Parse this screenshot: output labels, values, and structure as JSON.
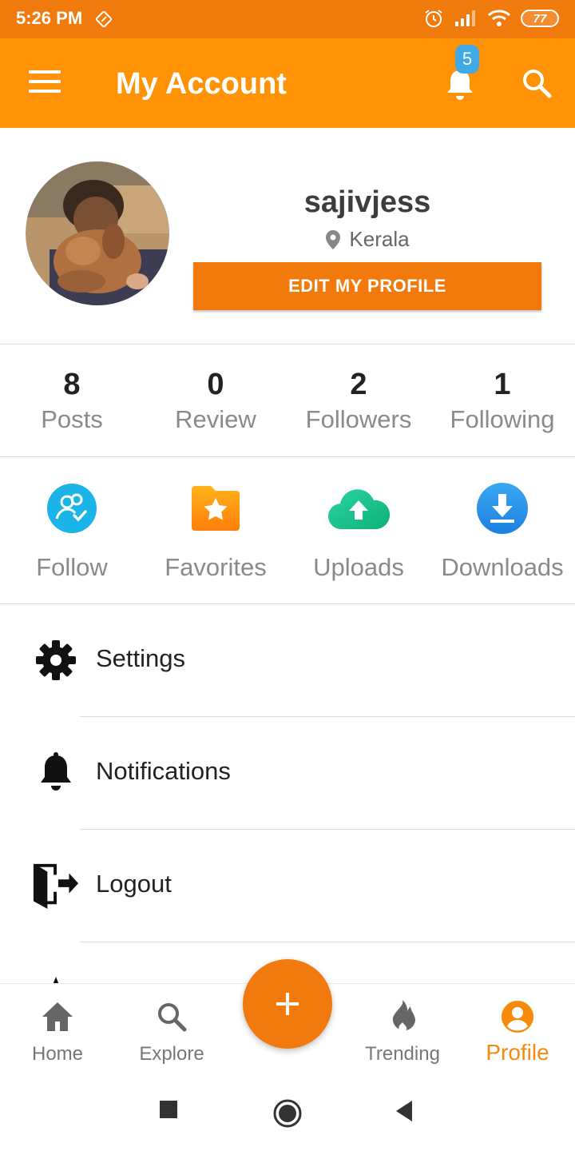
{
  "status_bar": {
    "time": "5:26 PM",
    "battery": "77"
  },
  "app_bar": {
    "title": "My Account",
    "notification_count": "5"
  },
  "profile": {
    "username": "sajivjess",
    "location": "Kerala",
    "edit_label": "EDIT MY PROFILE"
  },
  "stats": [
    {
      "value": "8",
      "label": "Posts"
    },
    {
      "value": "0",
      "label": "Review"
    },
    {
      "value": "2",
      "label": "Followers"
    },
    {
      "value": "1",
      "label": "Following"
    }
  ],
  "quick_actions": [
    {
      "label": "Follow",
      "icon": "follow-icon"
    },
    {
      "label": "Favorites",
      "icon": "favorites-icon"
    },
    {
      "label": "Uploads",
      "icon": "upload-cloud-icon"
    },
    {
      "label": "Downloads",
      "icon": "download-icon"
    }
  ],
  "menu": [
    {
      "label": "Settings",
      "icon": "gear-icon"
    },
    {
      "label": "Notifications",
      "icon": "bell-icon"
    },
    {
      "label": "Logout",
      "icon": "logout-icon"
    }
  ],
  "bottom_nav": {
    "items": [
      {
        "label": "Home",
        "icon": "home-icon"
      },
      {
        "label": "Explore",
        "icon": "search-icon"
      },
      {
        "label": "Trending",
        "icon": "flame-icon"
      },
      {
        "label": "Profile",
        "icon": "person-icon"
      }
    ],
    "active": "Profile",
    "fab_icon": "plus-icon"
  },
  "colors": {
    "status_bar": "#f17a0c",
    "app_bar": "#ff9305",
    "accent": "#f27a0c",
    "active_nav": "#f58a0b",
    "badge": "#3fa9e5"
  }
}
